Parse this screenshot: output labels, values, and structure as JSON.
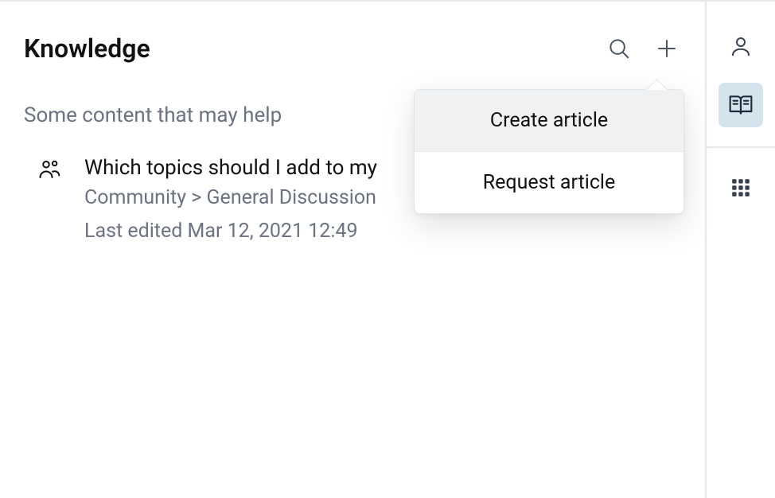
{
  "panel": {
    "title": "Knowledge",
    "subheader": "Some content that may help"
  },
  "article": {
    "title": "Which topics should I add to my",
    "breadcrumb": "Community > General Discussion",
    "last_edited": "Last edited Mar 12, 2021 12:49"
  },
  "dropdown": {
    "create_label": "Create article",
    "request_label": "Request article"
  },
  "rail": {
    "user_label": "user",
    "book_label": "knowledge",
    "apps_label": "apps"
  }
}
